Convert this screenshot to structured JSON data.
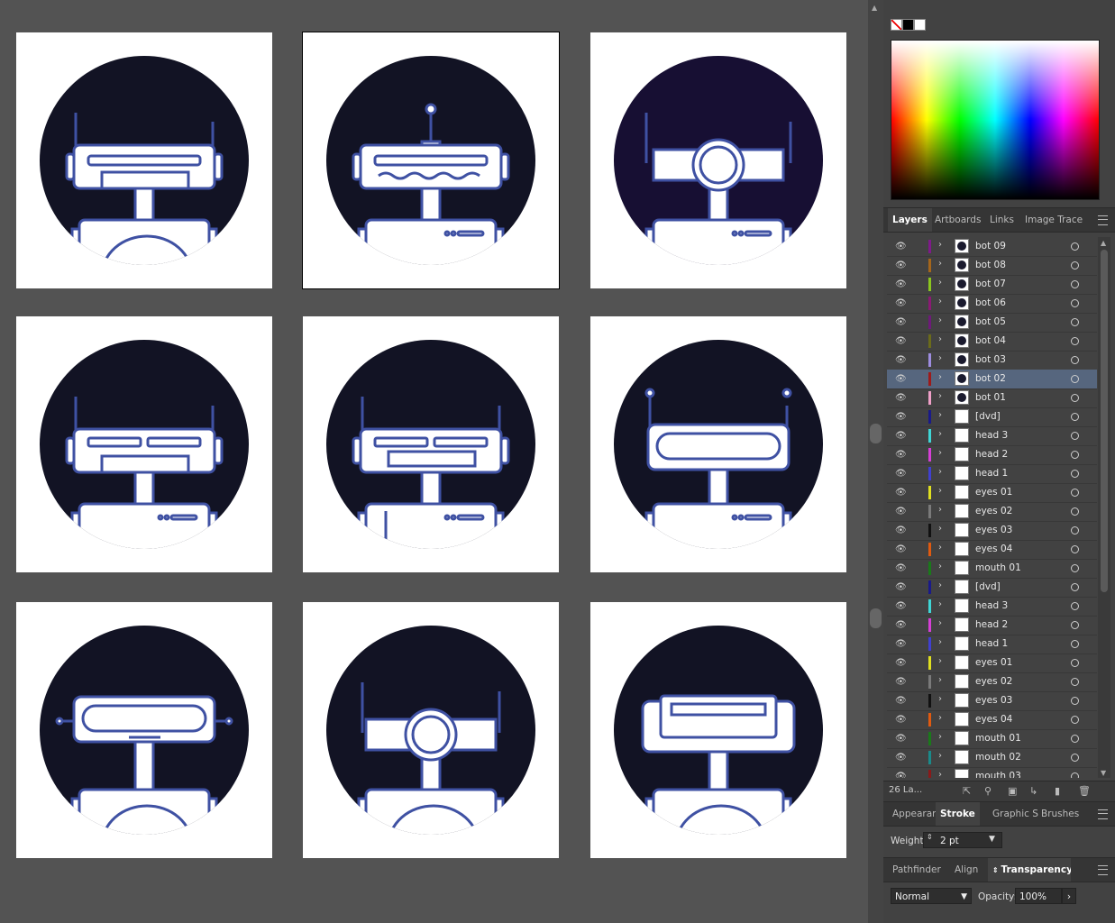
{
  "colors": {
    "robot_stroke": "#3f51a3",
    "bg_dark": "#121324",
    "bg_purple": "#170f33",
    "artboard": "#ffffff",
    "selected_layer": "#56667e"
  },
  "icons": {
    "visibility": "eye-icon",
    "expand": "chevron-right-icon",
    "target": "target-circle-icon"
  },
  "color_panel": {
    "swatches": [
      "none-swatch",
      "black-swatch",
      "white-swatch"
    ]
  },
  "layers_panel": {
    "tabs": [
      "Layers",
      "Artboards",
      "Links",
      "Image Trace"
    ],
    "active_tab": "Layers",
    "layers": [
      {
        "name": "bot 09",
        "color": "#7f1a8a",
        "thumb": "bot"
      },
      {
        "name": "bot 08",
        "color": "#a5661b",
        "thumb": "bot"
      },
      {
        "name": "bot 07",
        "color": "#8bc61e",
        "thumb": "bot"
      },
      {
        "name": "bot 06",
        "color": "#8a1a74",
        "thumb": "bot"
      },
      {
        "name": "bot 05",
        "color": "#6e1a7a",
        "thumb": "bot"
      },
      {
        "name": "bot 04",
        "color": "#6b6b1a",
        "thumb": "bot"
      },
      {
        "name": "bot 03",
        "color": "#9e8de0",
        "thumb": "bot"
      },
      {
        "name": "bot 02",
        "color": "#9e1a1a",
        "thumb": "bot",
        "selected": true
      },
      {
        "name": "bot 01",
        "color": "#f0a0c8",
        "thumb": "bot"
      },
      {
        "name": "[dvd]",
        "color": "#1a1a8a",
        "thumb": "blank"
      },
      {
        "name": "head 3",
        "color": "#3fd6d6",
        "thumb": "blank"
      },
      {
        "name": "head 2",
        "color": "#d63fd6",
        "thumb": "blank"
      },
      {
        "name": "head 1",
        "color": "#4040d0",
        "thumb": "blank"
      },
      {
        "name": "eyes 01",
        "color": "#e0e020",
        "thumb": "blank"
      },
      {
        "name": "eyes 02",
        "color": "#7a7a7a",
        "thumb": "blank"
      },
      {
        "name": "eyes 03",
        "color": "#111111",
        "thumb": "blank"
      },
      {
        "name": "eyes 04",
        "color": "#e05a10",
        "thumb": "blank"
      },
      {
        "name": "mouth 01",
        "color": "#1a7a1a",
        "thumb": "blank"
      },
      {
        "name": "[dvd]",
        "color": "#1a1a8a",
        "thumb": "blank"
      },
      {
        "name": "head 3",
        "color": "#3fd6d6",
        "thumb": "blank"
      },
      {
        "name": "head 2",
        "color": "#d63fd6",
        "thumb": "blank"
      },
      {
        "name": "head 1",
        "color": "#4040d0",
        "thumb": "blank"
      },
      {
        "name": "eyes 01",
        "color": "#e0e020",
        "thumb": "blank"
      },
      {
        "name": "eyes 02",
        "color": "#7a7a7a",
        "thumb": "blank"
      },
      {
        "name": "eyes 03",
        "color": "#111111",
        "thumb": "blank"
      },
      {
        "name": "eyes 04",
        "color": "#e05a10",
        "thumb": "blank"
      },
      {
        "name": "mouth 01",
        "color": "#1a7a1a",
        "thumb": "blank"
      },
      {
        "name": "mouth 02",
        "color": "#1a8a8a",
        "thumb": "blank"
      },
      {
        "name": "mouth 03",
        "color": "#8a1a1a",
        "thumb": "blank"
      }
    ],
    "footer_count": "26 La..."
  },
  "stroke_panel": {
    "tabs": [
      "Appearan",
      "Stroke",
      "Graphic S",
      "Brushes"
    ],
    "active_tab": "Stroke",
    "weight_label": "Weight:",
    "weight_value": "2 pt"
  },
  "transparency_panel": {
    "tabs": [
      "Pathfinder",
      "Align",
      "Transparency"
    ],
    "active_tab": "Transparency",
    "blend_mode": "Normal",
    "opacity_label": "Opacity:",
    "opacity_value": "100%"
  },
  "artboards": [
    {
      "bg": "#121324",
      "antenna": "double",
      "eyes": "visor",
      "mouth": "bar",
      "neck": "mid",
      "body": "dome"
    },
    {
      "bg": "#121324",
      "antenna": "center",
      "eyes": "visor",
      "mouth": "wave",
      "neck": "mid",
      "body": "box",
      "selected": true
    },
    {
      "bg": "#170f33",
      "antenna": "double-wide",
      "eyes": "cyclops",
      "mouth": "none",
      "neck": "mid",
      "body": "box"
    },
    {
      "bg": "#121324",
      "antenna": "double",
      "eyes": "split",
      "mouth": "bar",
      "neck": "mid",
      "body": "box"
    },
    {
      "bg": "#121324",
      "antenna": "double",
      "eyes": "split",
      "mouth": "box",
      "neck": "mid",
      "body": "box-lines"
    },
    {
      "bg": "#121324",
      "antenna": "double-ball",
      "eyes": "pill",
      "mouth": "none",
      "neck": "mid",
      "body": "box"
    },
    {
      "bg": "#121324",
      "antenna": "side",
      "eyes": "pill",
      "mouth": "slot",
      "neck": "long",
      "body": "dome"
    },
    {
      "bg": "#121324",
      "antenna": "double",
      "eyes": "cyclops",
      "mouth": "none",
      "neck": "mid",
      "body": "dome"
    },
    {
      "bg": "#121324",
      "antenna": "none",
      "eyes": "wide",
      "mouth": "none",
      "neck": "mid",
      "body": "dome"
    }
  ]
}
